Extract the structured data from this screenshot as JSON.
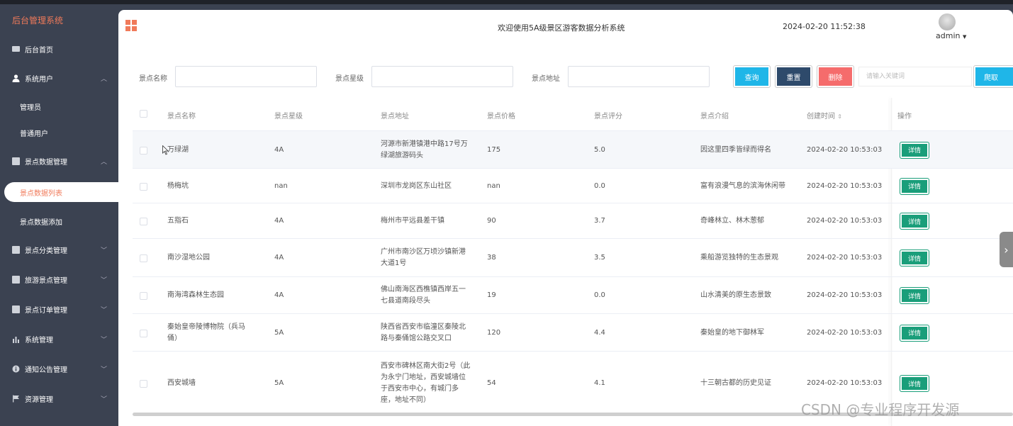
{
  "sidebar": {
    "brand": "后台管理系统",
    "items": [
      {
        "label": "后台首页",
        "icon": "monitor-icon"
      },
      {
        "label": "系统用户",
        "icon": "user-icon",
        "expanded": true
      },
      {
        "label": "管理员"
      },
      {
        "label": "普通用户"
      },
      {
        "label": "景点数据管理",
        "icon": "edit-icon",
        "expanded": true
      },
      {
        "label": "景点数据列表",
        "active": true
      },
      {
        "label": "景点数据添加"
      },
      {
        "label": "景点分类管理",
        "icon": "edit-icon"
      },
      {
        "label": "旅游景点管理",
        "icon": "edit-icon"
      },
      {
        "label": "景点订单管理",
        "icon": "edit-icon"
      },
      {
        "label": "系统管理",
        "icon": "bar-chart-icon"
      },
      {
        "label": "通知公告管理",
        "icon": "info-icon"
      },
      {
        "label": "资源管理",
        "icon": "flag-icon"
      }
    ]
  },
  "header": {
    "title": "欢迎使用5A级景区游客数据分析系统",
    "datetime": "2024-02-20 11:52:38",
    "user": "admin"
  },
  "search": {
    "name_label": "景点名称",
    "level_label": "景点星级",
    "address_label": "景点地址",
    "query_btn": "查询",
    "reset_btn": "重置",
    "delete_btn": "删除",
    "keyword_placeholder": "请输入关键词",
    "crawl_btn": "爬取"
  },
  "table": {
    "headers": [
      "景点名称",
      "景点星级",
      "景点地址",
      "景点价格",
      "景点评分",
      "景点介绍",
      "创建时间",
      "操作"
    ],
    "sort_icon": "sort-icon",
    "detail_label": "详情",
    "rows": [
      {
        "name": "万绿湖",
        "level": "4A",
        "address": [
          "河源市新港镇港中路17号万",
          "绿湖旅游码头"
        ],
        "price": "175",
        "score": "5.0",
        "intro": "因这里四季皆绿而得名",
        "created": "2024-02-20 10:53:03"
      },
      {
        "name": "杨梅坑",
        "level": "nan",
        "address": [
          "深圳市龙岗区东山社区"
        ],
        "price": "nan",
        "score": "0.0",
        "intro": "富有浪漫气息的滨海休闲带",
        "created": "2024-02-20 10:53:03"
      },
      {
        "name": "五指石",
        "level": "4A",
        "address": [
          "梅州市平远县差干镇"
        ],
        "price": "90",
        "score": "3.7",
        "intro": "奇峰林立、林木葱郁",
        "created": "2024-02-20 10:53:03"
      },
      {
        "name": "南沙湿地公园",
        "level": "4A",
        "address": [
          "广州市南沙区万顷沙镇新港",
          "大道1号"
        ],
        "price": "38",
        "score": "3.5",
        "intro": "乘船游览独特的生态景观",
        "created": "2024-02-20 10:53:03"
      },
      {
        "name": "南海湾森林生态园",
        "level": "4A",
        "address": [
          "佛山南海区西樵镇西岸五一",
          "七县道南段尽头"
        ],
        "price": "19",
        "score": "0.0",
        "intro": "山水清美的原生态景致",
        "created": "2024-02-20 10:53:03"
      },
      {
        "name": [
          "秦始皇帝陵博物院（兵马",
          "俑）"
        ],
        "level": "5A",
        "address": [
          "陕西省西安市临潼区秦陵北",
          "路与秦俑馆公路交叉口"
        ],
        "price": "120",
        "score": "4.4",
        "intro": "秦始皇的地下御林军",
        "created": "2024-02-20 10:53:03"
      },
      {
        "name": "西安城墙",
        "level": "5A",
        "address": [
          "西安市碑林区南大街2号（此",
          "为永宁门地址，西安城墙位",
          "于西安市中心，有城门多",
          "座，地址不同）"
        ],
        "price": "54",
        "score": "4.1",
        "intro": "十三朝古都的历史见证",
        "created": "2024-02-20 10:53:03"
      }
    ]
  },
  "watermark": "CSDN @专业程序开发源",
  "colors": {
    "accent": "#f07a5a",
    "sidebar": "#3b4251",
    "query": "#1fb6e8",
    "reset": "#2e4a6b",
    "delete": "#f56c6c",
    "detail": "#1a9e7a"
  }
}
